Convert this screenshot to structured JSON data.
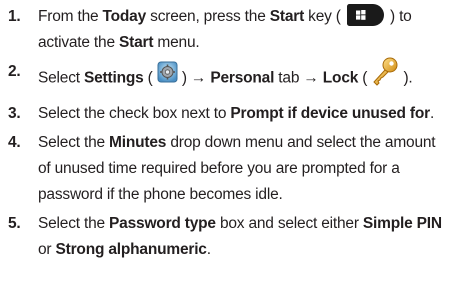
{
  "steps": [
    {
      "num": "1.",
      "line1": [
        {
          "t": "From the ",
          "b": false
        },
        {
          "t": "Today",
          "b": true
        },
        {
          "t": " screen, press the ",
          "b": false
        },
        {
          "t": "Start",
          "b": true
        },
        {
          "t": " key ( ",
          "b": false
        },
        {
          "icon": "start-key-icon"
        },
        {
          "t": " ) to",
          "b": false
        }
      ],
      "line2": [
        {
          "t": "activate the ",
          "b": false
        },
        {
          "t": "Start",
          "b": true
        },
        {
          "t": " menu.",
          "b": false
        }
      ]
    },
    {
      "num": "2.",
      "line1": [
        {
          "t": "Select ",
          "b": false
        },
        {
          "t": "Settings",
          "b": true
        },
        {
          "t": " ( ",
          "b": false
        },
        {
          "icon": "settings-icon"
        },
        {
          "t": " ) ",
          "b": false
        },
        {
          "t": "→ Personal",
          "b": true
        },
        {
          "t": " tab ",
          "b": false
        },
        {
          "t": "→ Lock",
          "b": true
        },
        {
          "t": " ( ",
          "b": false
        },
        {
          "icon": "lock-key-icon"
        },
        {
          "t": " ).",
          "b": false
        }
      ]
    },
    {
      "num": "3.",
      "line1": [
        {
          "t": "Select the check box next to ",
          "b": false
        },
        {
          "t": "Prompt if device unused for",
          "b": true
        },
        {
          "t": ".",
          "b": false
        }
      ]
    },
    {
      "num": "4.",
      "line1": [
        {
          "t": "Select the ",
          "b": false
        },
        {
          "t": "Minutes",
          "b": true
        },
        {
          "t": " drop down menu and select the amount",
          "b": false
        }
      ],
      "line2": [
        {
          "t": "of unused time required before you are prompted for a",
          "b": false
        }
      ],
      "line3": [
        {
          "t": "password if the phone becomes idle.",
          "b": false
        }
      ]
    },
    {
      "num": "5.",
      "line1": [
        {
          "t": "Select the ",
          "b": false
        },
        {
          "t": "Password type",
          "b": true
        },
        {
          "t": " box and select either ",
          "b": false
        },
        {
          "t": "Simple PIN",
          "b": true
        }
      ],
      "line2": [
        {
          "t": "or ",
          "b": false
        },
        {
          "t": "Strong alphanumeric",
          "b": true
        },
        {
          "t": ".",
          "b": false
        }
      ]
    }
  ]
}
